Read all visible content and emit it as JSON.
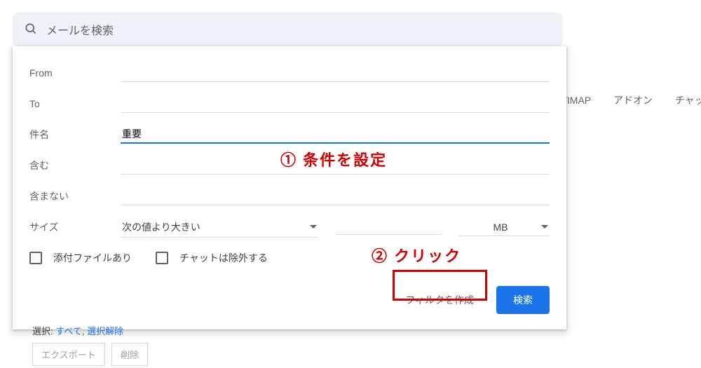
{
  "search": {
    "placeholder": "メールを検索"
  },
  "bg_tabs": {
    "imap": "/IMAP",
    "addons": "アドオン",
    "chat": "チャット"
  },
  "form": {
    "from_label": "From",
    "to_label": "To",
    "subject_label": "件名",
    "subject_value": "重要",
    "include_label": "含む",
    "exclude_label": "含まない",
    "size_label": "サイズ",
    "size_op": "次の値より大きい",
    "size_unit": "MB",
    "chk_attach": "添付ファイルあり",
    "chk_nochat": "チャットは除外する",
    "btn_create": "フィルタを作成",
    "btn_search": "検索"
  },
  "annot": {
    "step1": "① 条件を設定",
    "step2": "② クリック"
  },
  "below": {
    "select_label": "選択:",
    "all": "すべて",
    "sep": ",",
    "none": "選択解除",
    "export": "エクスポート",
    "delete": "削除"
  }
}
